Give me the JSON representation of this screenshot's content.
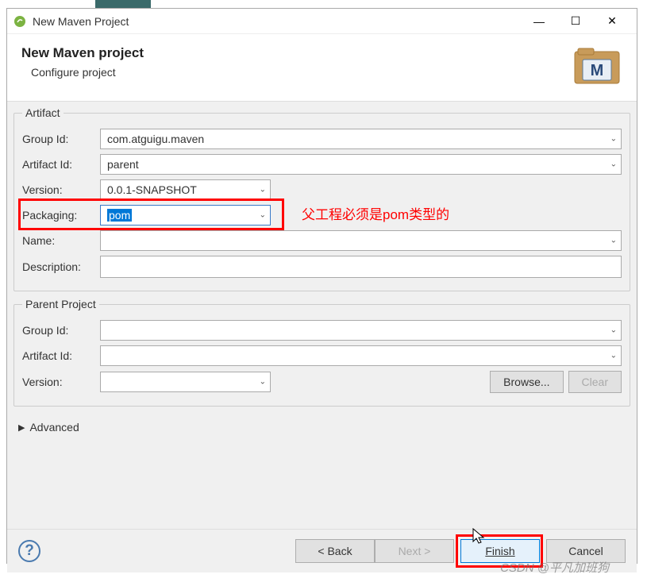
{
  "titlebar": {
    "title": "New Maven Project"
  },
  "header": {
    "title": "New Maven project",
    "subtitle": "Configure project"
  },
  "artifact": {
    "legend": "Artifact",
    "group_id_label": "Group Id:",
    "group_id_value": "com.atguigu.maven",
    "artifact_id_label": "Artifact Id:",
    "artifact_id_value": "parent",
    "version_label": "Version:",
    "version_value": "0.0.1-SNAPSHOT",
    "packaging_label": "Packaging:",
    "packaging_value": "pom",
    "name_label": "Name:",
    "name_value": "",
    "description_label": "Description:",
    "description_value": ""
  },
  "annotation": {
    "packaging_note": "父工程必须是pom类型的"
  },
  "parent": {
    "legend": "Parent Project",
    "group_id_label": "Group Id:",
    "group_id_value": "",
    "artifact_id_label": "Artifact Id:",
    "artifact_id_value": "",
    "version_label": "Version:",
    "version_value": "",
    "browse_label": "Browse...",
    "clear_label": "Clear"
  },
  "advanced_label": "Advanced",
  "footer": {
    "back_label": "< Back",
    "next_label": "Next >",
    "finish_label": "Finish",
    "cancel_label": "Cancel"
  },
  "watermark": "CSDN @平凡加班狗"
}
